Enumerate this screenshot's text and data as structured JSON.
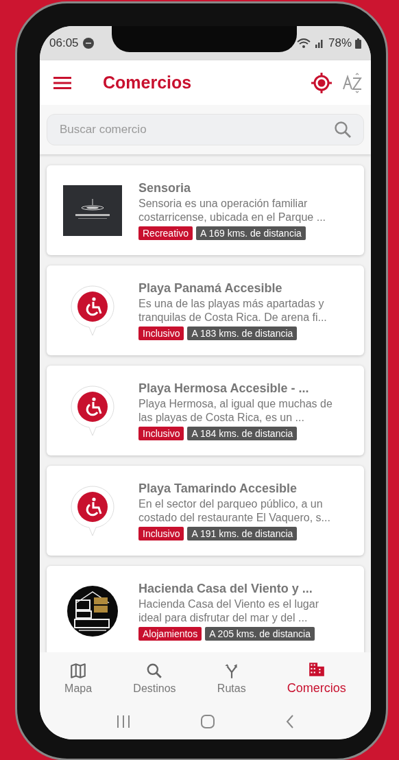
{
  "status_bar": {
    "time": "06:05",
    "battery": "78%"
  },
  "app_bar": {
    "title": "Comercios"
  },
  "search": {
    "placeholder": "Buscar comercio"
  },
  "items": [
    {
      "kind": "square-logo",
      "title": "Sensoria",
      "description": "Sensoria es una operación familiar costarricense, ubicada en el Parque ...",
      "category": "Recreativo",
      "distance": "A 169 kms. de distancia"
    },
    {
      "kind": "pin",
      "title": "Playa Panamá Accesible",
      "description": "Es una de las playas más apartadas y tranquilas de Costa Rica. De arena fi...",
      "category": "Inclusivo",
      "distance": "A 183 kms. de distancia"
    },
    {
      "kind": "pin",
      "title": "Playa Hermosa Accesible - ...",
      "description": "Playa Hermosa, al igual que muchas de las playas de Costa Rica, es un ...",
      "category": "Inclusivo",
      "distance": "A 184 kms. de distancia"
    },
    {
      "kind": "pin",
      "title": "Playa Tamarindo Accesible",
      "description": "En el sector del parqueo público, a un costado del restaurante El Vaquero, s...",
      "category": "Inclusivo",
      "distance": "A 191 kms. de distancia"
    },
    {
      "kind": "round-logo",
      "title": "Hacienda Casa del Viento y ...",
      "description": "Hacienda Casa del Viento es el lugar ideal para disfrutar del mar y del ...",
      "category": "Alojamientos",
      "distance": "A 205 kms. de distancia"
    }
  ],
  "tabs": [
    {
      "kind": "map",
      "label": "Mapa",
      "selected": false
    },
    {
      "kind": "search",
      "label": "Destinos",
      "selected": false
    },
    {
      "kind": "routes",
      "label": "Rutas",
      "selected": false
    },
    {
      "kind": "building",
      "label": "Comercios",
      "selected": true
    }
  ]
}
